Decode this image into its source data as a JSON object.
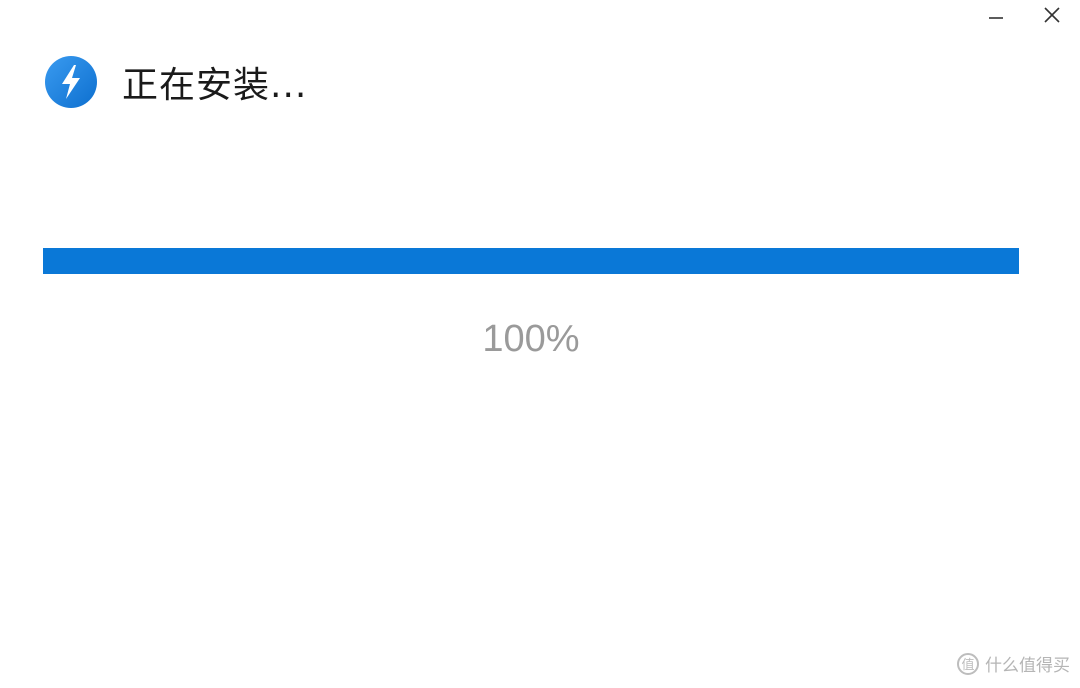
{
  "window": {
    "minimize_icon": "minimize-icon",
    "close_icon": "close-icon"
  },
  "header": {
    "logo_icon": "lightning-bolt-icon",
    "title": "正在安装..."
  },
  "progress": {
    "value": 100,
    "label": "100%",
    "fill_color": "#0a78d7",
    "track_color": "#e6e6e6"
  },
  "watermark": {
    "text": "什么值得买",
    "icon_glyph": "值"
  },
  "colors": {
    "accent": "#0a78d7",
    "logo_bg": "#1e88e5"
  }
}
